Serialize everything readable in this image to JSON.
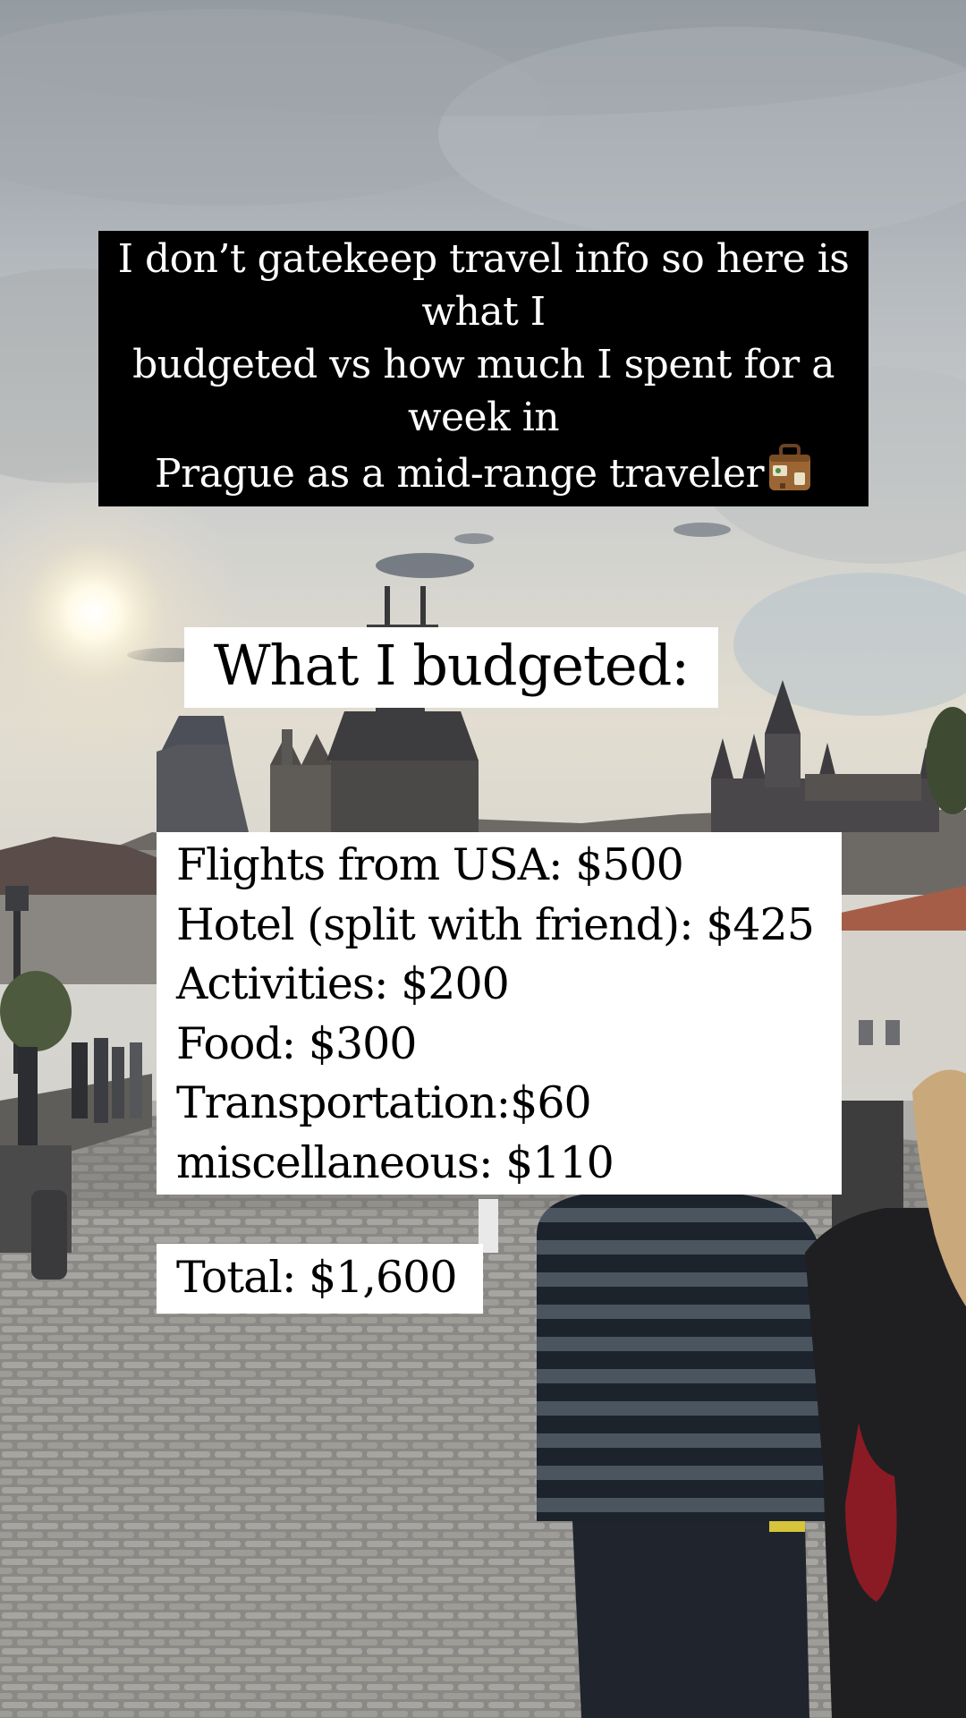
{
  "caption": {
    "lines": [
      "I don’t gatekeep travel info so here is",
      "what I",
      "budgeted vs how much I spent for a",
      "week in",
      "Prague as a mid-range traveler"
    ],
    "emoji": "suitcase-icon"
  },
  "heading": {
    "text": "What I budgeted:"
  },
  "budget": {
    "items": [
      "Flights from USA: $500",
      "Hotel (split with friend): $425",
      "Activities: $200",
      "Food: $300",
      "Transportation:$60",
      "miscellaneous: $110"
    ],
    "total": "Total: $1,600"
  },
  "colors": {
    "caption_bg": "#000000",
    "caption_text": "#ffffff",
    "box_bg": "#ffffff",
    "box_text": "#000000"
  }
}
